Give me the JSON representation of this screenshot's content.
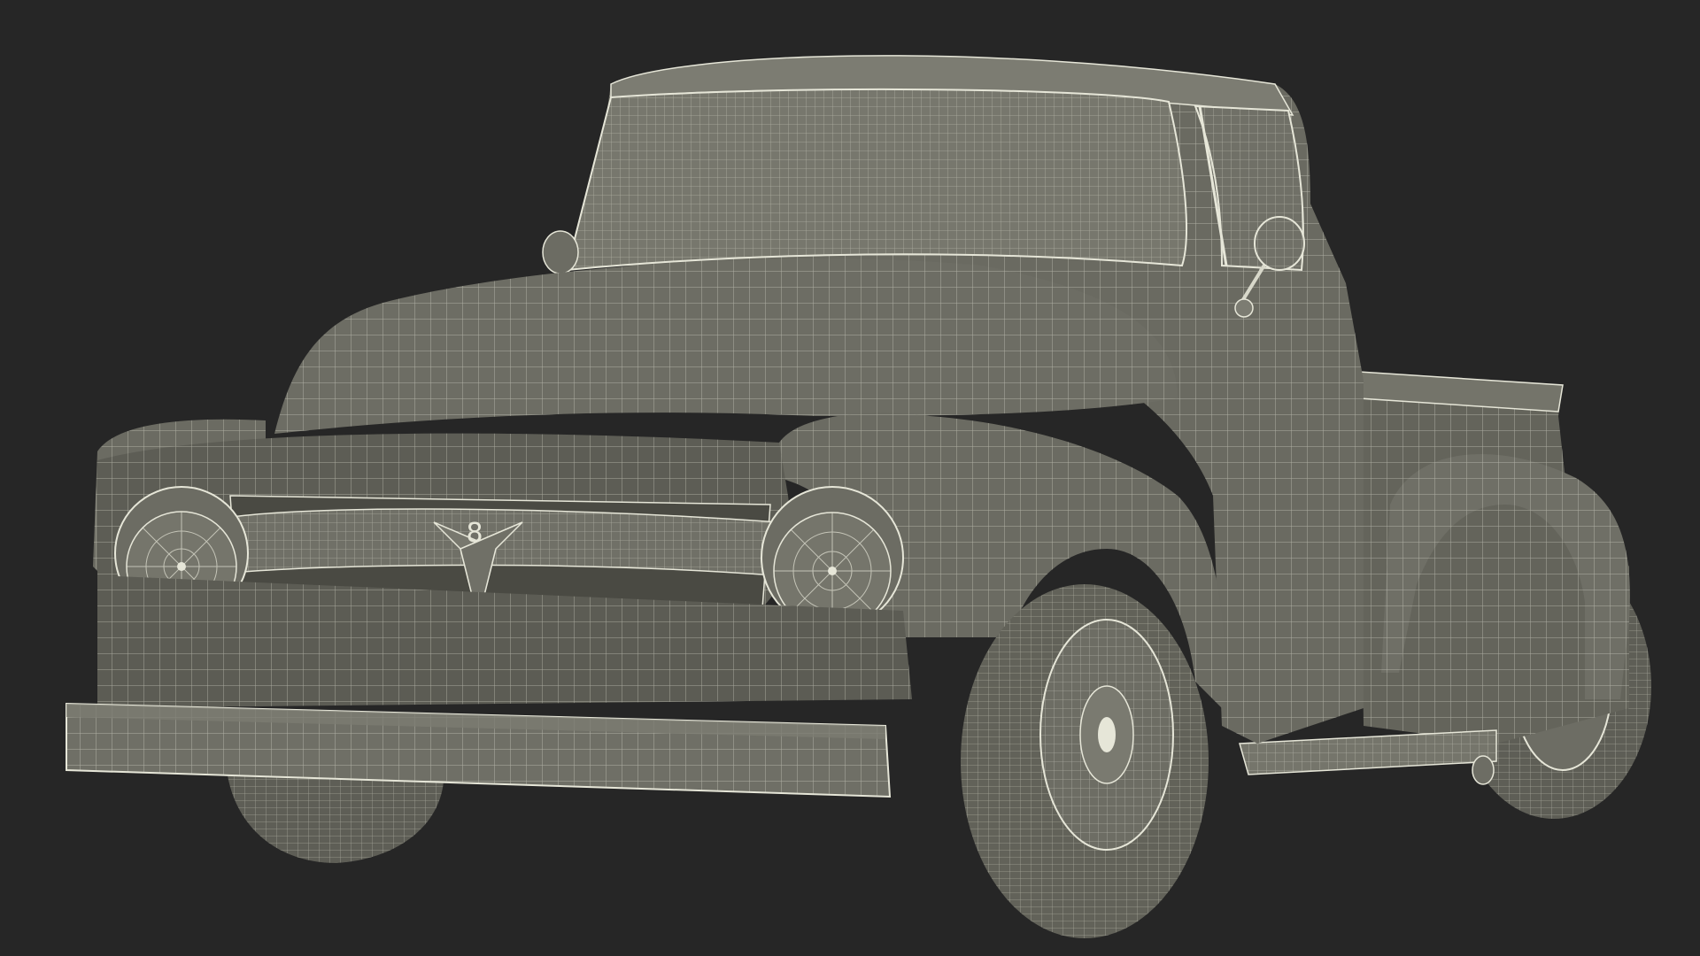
{
  "scene": {
    "subject": "",
    "background_color": "#262626",
    "body_color": "#6f6f64",
    "body_shade_color": "#4f4f47",
    "wire_color": "#e6e6d8",
    "tire_color": "#6a6a61",
    "badge_text": "8"
  }
}
